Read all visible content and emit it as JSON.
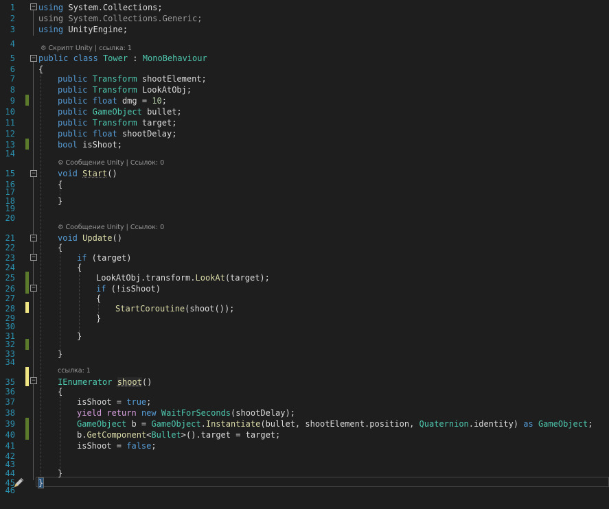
{
  "editor": {
    "line_numbers": [
      "1",
      "2",
      "3",
      "4",
      "5",
      "6",
      "7",
      "8",
      "9",
      "10",
      "11",
      "12",
      "13",
      "14",
      "15",
      "16",
      "17",
      "18",
      "19",
      "20",
      "21",
      "22",
      "23",
      "24",
      "25",
      "26",
      "27",
      "28",
      "29",
      "30",
      "31",
      "32",
      "33",
      "34",
      "35",
      "36",
      "37",
      "38",
      "39",
      "40",
      "41",
      "42",
      "43",
      "44",
      "45",
      "46"
    ],
    "codelens": {
      "class_refs": "Скрипт Unity | ссылка: 1",
      "start_msg": "Сообщение Unity | Ссылок: 0",
      "update_msg": "Сообщение Unity | Ссылок: 0",
      "shoot_refs": "ссылка: 1"
    },
    "tokens": {
      "using": "using",
      "ns1": "System.Collections;",
      "ns2": "System.Collections.Generic;",
      "ns3": "UnityEngine;",
      "public": "public",
      "class": "class",
      "tower": "Tower",
      "colon": " : ",
      "monobehaviour": "MonoBehaviour",
      "lbrace": "{",
      "rbrace": "}",
      "transform_t": "Transform",
      "float_t": "float",
      "gameobject_t": "GameObject",
      "bool_t": "bool",
      "void_t": "void",
      "shootElement": "shootElement;",
      "lookAtObj": "LookAtObj;",
      "dmg": "dmg = ",
      "ten": "10",
      "semicolon": ";",
      "bullet": "bullet;",
      "target": "target;",
      "shootDelay": "shootDelay;",
      "isShoot": "isShoot;",
      "start": "Start",
      "update": "Update",
      "parens": "()",
      "if": "if",
      "cond_target": " (target)",
      "lookat_pre": "LookAtObj.transform.",
      "lookat_m": "LookAt",
      "lookat_post": "(target);",
      "cond_notshoot": " (!isShoot)",
      "startcoroutine": "StartCoroutine",
      "startcoroutine_arg": "(shoot());",
      "ienumerator": "IEnumerator",
      "shoot": "shoot",
      "isShoot_eq": "isShoot = ",
      "true": "true",
      "false": "false",
      "yield": "yield",
      "return": "return",
      "new": "new",
      "waitforseconds": "WaitForSeconds",
      "wait_arg": "(shootDelay);",
      "go_b": "GameObject",
      "b_eq": " b = ",
      "instantiate": "Instantiate",
      "inst_args": "(bullet, shootElement.position, ",
      "quaternion": "Quaternion",
      "identity": ".identity) ",
      "as": "as",
      "getcomp_pre": "b.",
      "getcomp": "GetComponent",
      "lt": "<",
      "bullet_t": "Bullet",
      "getcomp_post": ">().target = target;",
      "dot": "."
    }
  }
}
